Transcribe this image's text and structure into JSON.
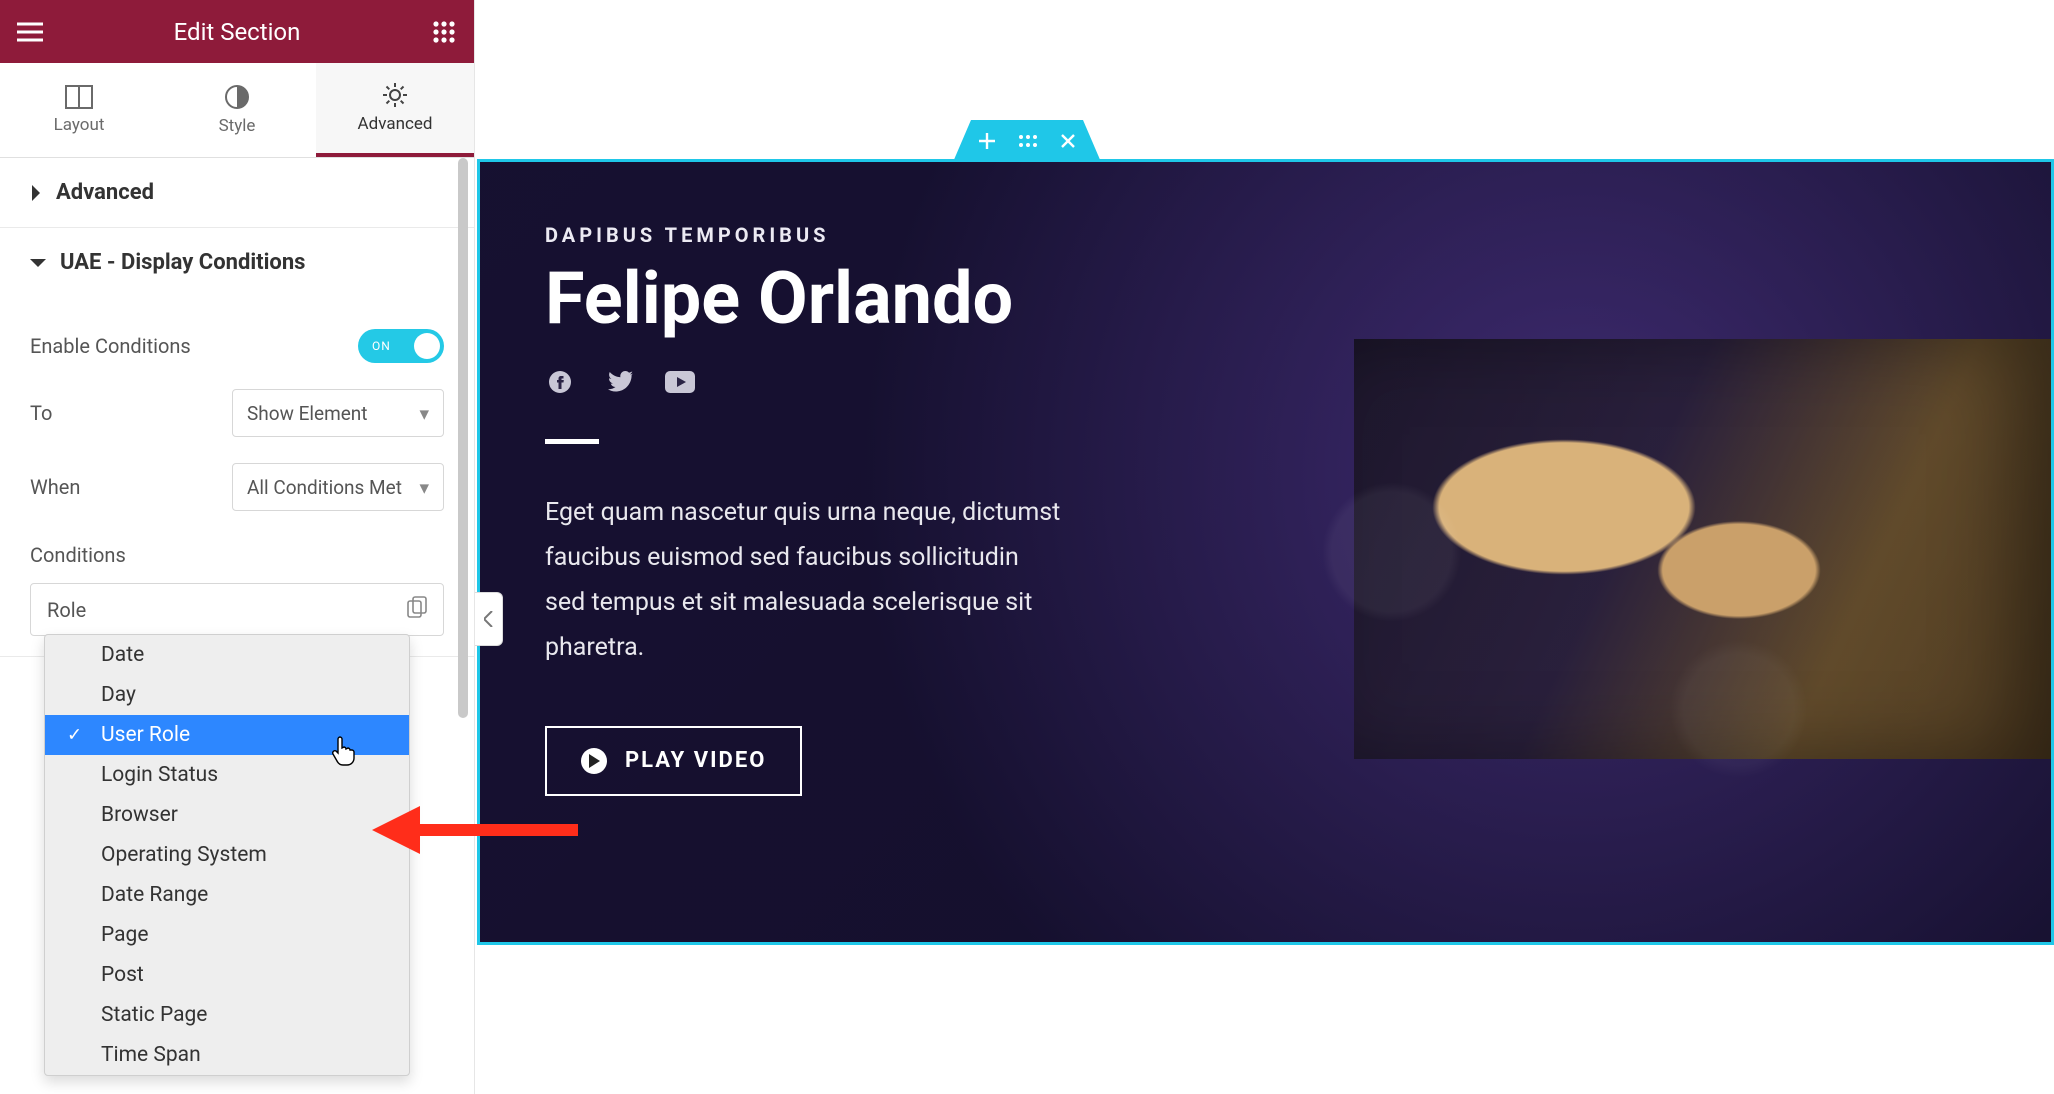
{
  "header": {
    "title": "Edit Section"
  },
  "tabs": {
    "layout": "Layout",
    "style": "Style",
    "advanced": "Advanced",
    "active": "advanced"
  },
  "accordion": {
    "advanced": {
      "title": "Advanced"
    },
    "conditions": {
      "title": "UAE - Display Conditions"
    }
  },
  "controls": {
    "enable_label": "Enable Conditions",
    "enable_state": "ON",
    "to_label": "To",
    "to_value": "Show Element",
    "when_label": "When",
    "when_value": "All Conditions Met",
    "conditions_label": "Conditions",
    "condition_selected": "Role"
  },
  "dropdown_options": [
    "Date",
    "Day",
    "User Role",
    "Login Status",
    "Browser",
    "Operating System",
    "Date Range",
    "Page",
    "Post",
    "Static Page",
    "Time Span"
  ],
  "dropdown_selected_index": 2,
  "hero": {
    "eyebrow": "DAPIBUS TEMPORIBUS",
    "title": "Felipe Orlando",
    "paragraph": "Eget quam nascetur quis urna neque, dictumst faucibus euismod sed faucibus sollicitudin sed tempus et sit malesuada scelerisque sit pharetra.",
    "button": "PLAY VIDEO"
  }
}
